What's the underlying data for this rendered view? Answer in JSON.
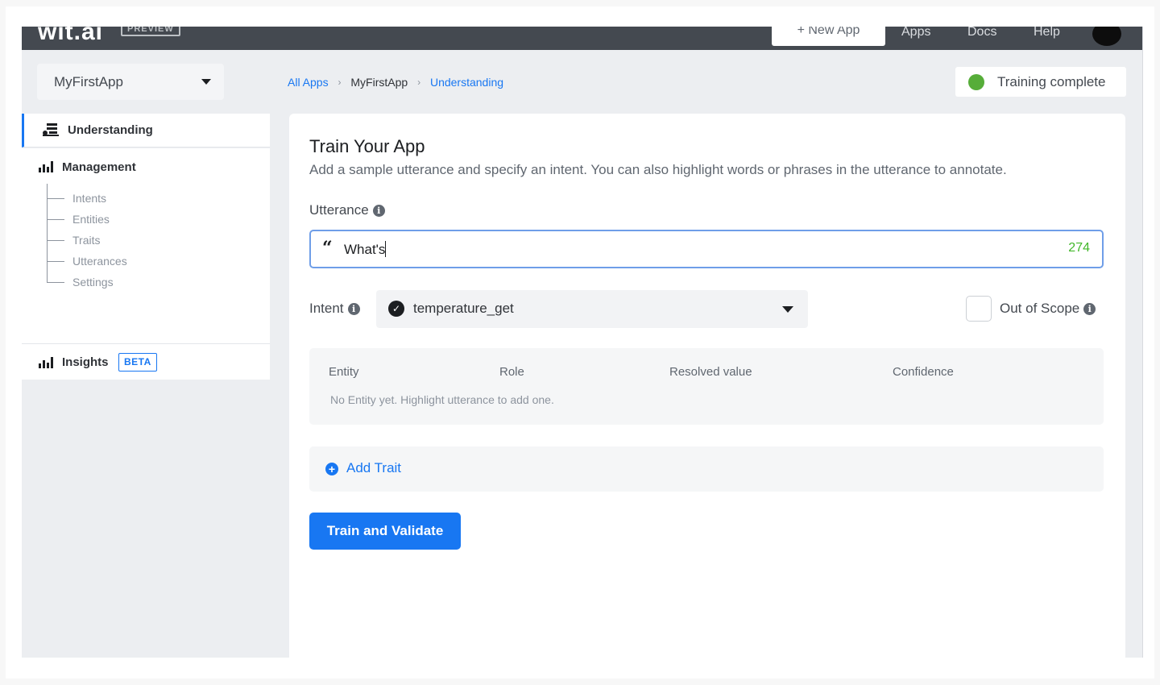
{
  "topbar": {
    "logo": "wit.ai",
    "badge": "PREVIEW",
    "new_app": "+ New App",
    "nav": [
      "Apps",
      "Docs",
      "Help"
    ]
  },
  "sidebar": {
    "app_select": "MyFirstApp",
    "understanding": "Understanding",
    "management": {
      "title": "Management",
      "items": [
        "Intents",
        "Entities",
        "Traits",
        "Utterances",
        "Settings"
      ]
    },
    "insights": {
      "title": "Insights",
      "badge": "BETA"
    }
  },
  "breadcrumb": [
    "All Apps",
    "MyFirstApp",
    "Understanding"
  ],
  "status": {
    "text": "Training complete",
    "color": "#56ad39"
  },
  "card": {
    "title": "Train Your App",
    "subtitle": "Add a sample utterance and specify an intent. You can also highlight words or phrases in the utterance to annotate.",
    "utterance_label": "Utterance",
    "utterance_value": "What's",
    "char_count": "274",
    "intent_label": "Intent",
    "intent_value": "temperature_get",
    "out_of_scope_label": "Out of Scope",
    "entity_table": {
      "headers": [
        "Entity",
        "Role",
        "Resolved value",
        "Confidence"
      ],
      "empty": "No Entity yet. Highlight utterance to add one."
    },
    "add_trait": "Add Trait",
    "train_button": "Train and Validate"
  },
  "colors": {
    "accent": "#1877f2",
    "topbar": "#444950"
  }
}
